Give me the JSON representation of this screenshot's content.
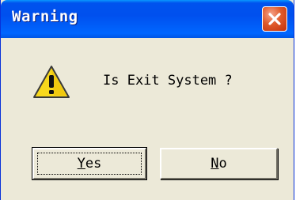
{
  "dialog": {
    "title": "Warning",
    "message": "Is Exit System ?",
    "icon": "warning-icon",
    "close_icon": "close-icon"
  },
  "buttons": {
    "yes": {
      "mnemonic": "Y",
      "rest": "es"
    },
    "no": {
      "mnemonic": "N",
      "rest": "o"
    }
  },
  "colors": {
    "title_bar": "#0053ee",
    "close_button": "#e05a2a",
    "dialog_background": "#ece9d8",
    "warning_yellow": "#f8d81c"
  }
}
